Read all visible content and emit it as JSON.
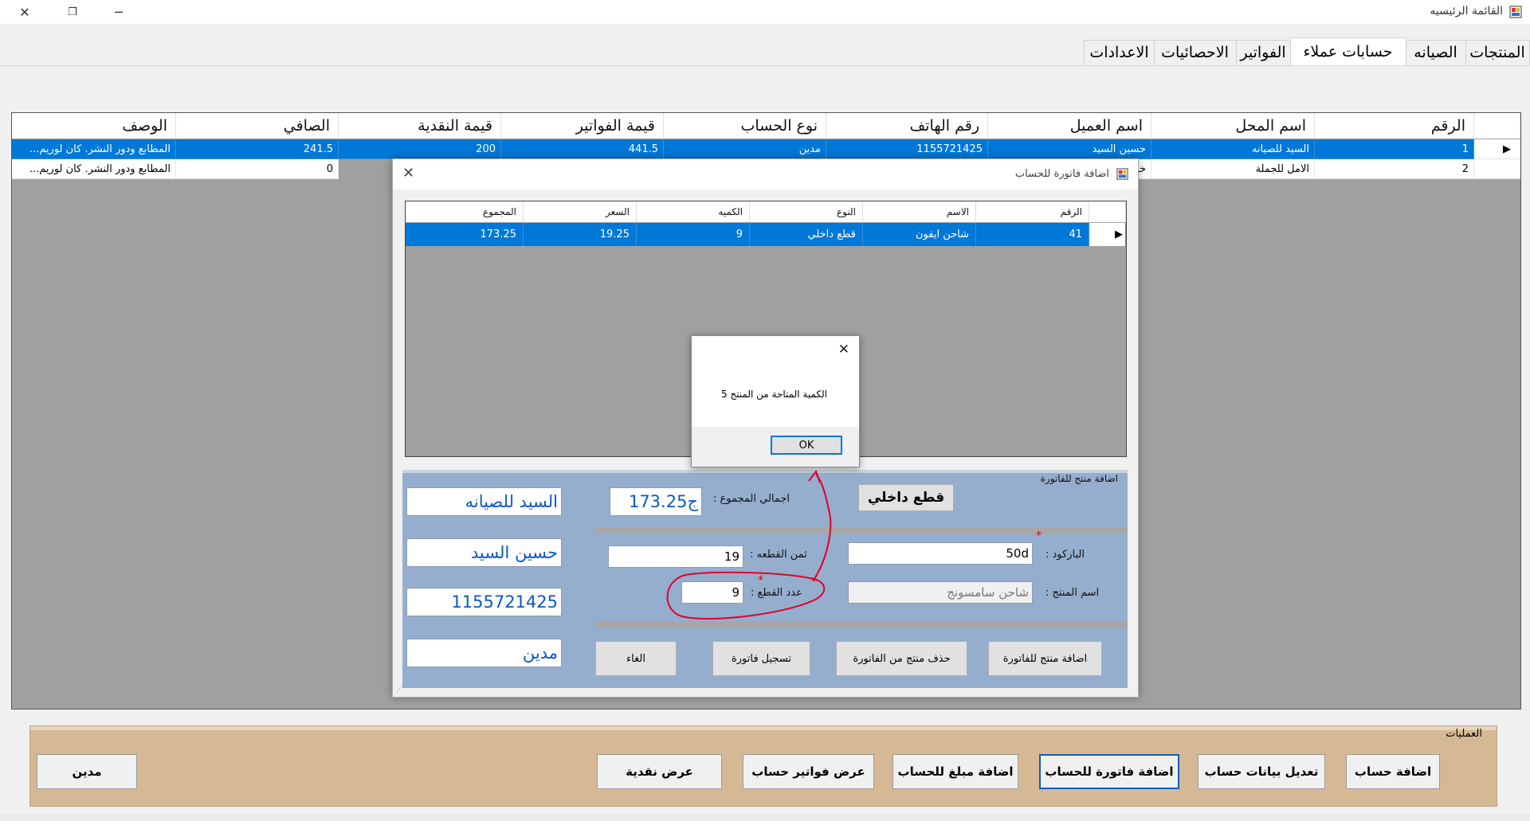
{
  "window": {
    "title": "القائمة الرئيسيه"
  },
  "tabs": [
    "المنتجات",
    "الصيانه",
    "حسابات عملاء",
    "الفواتير",
    "الاحصائيات",
    "الاعدادات"
  ],
  "main_grid": {
    "headers": [
      "الرقم",
      "اسم المحل",
      "اسم العميل",
      "رقم الهاتف",
      "نوع الحساب",
      "قيمة الفواتير",
      "قيمة النقدية",
      "الصافي",
      "الوصف"
    ],
    "rows": [
      [
        "1",
        "السيد للصيانه",
        "حسين السيد",
        "1155721425",
        "مدين",
        "441.5",
        "200",
        "241.5",
        "المطابع ودور النشر. كان لوريم..."
      ],
      [
        "2",
        "الامل للجملة",
        "خا",
        "",
        "",
        "",
        "",
        "0",
        "المطابع ودور النشر. كان لوريم..."
      ]
    ]
  },
  "invoice_dialog": {
    "title": "اضافة فاتورة للحساب",
    "grid_headers": [
      "الرقم",
      "الاسم",
      "النوع",
      "الكميه",
      "السعر",
      "المجموع"
    ],
    "grid_row": [
      "41",
      "شاحن ايفون",
      "قطع داخلي",
      "9",
      "19.25",
      "173.25"
    ],
    "panel_title": "اضافة منتج للفاتورة",
    "category_button": "قطع داخلي",
    "total_label": "اجمالي المجموع :",
    "total_value": "173.25ج",
    "shop_value": "السيد للصيانه",
    "customer_value": "حسين السيد",
    "phone_value": "1155721425",
    "account_type_value": "مدين",
    "barcode_label": "الباركود :",
    "barcode_value": "50d",
    "unit_price_label": "ثمن القطعه :",
    "unit_price_value": "19",
    "product_name_label": "اسم المنتج :",
    "product_name_value": "شاحن سامسونج",
    "pieces_label": "عدد القطع :",
    "pieces_value": "9",
    "buttons": {
      "add": "اضافة منتج للفاتورة",
      "remove": "حذف منتج من الفاتورة",
      "save": "تسجيل فاتورة",
      "cancel": "الغاء"
    }
  },
  "message_box": {
    "text": "الكمية المتاحة من المنتج 5",
    "ok": "OK"
  },
  "operations": {
    "title": "العمليات",
    "buttons": [
      "اضافة حساب",
      "تعديل بيانات حساب",
      "اضافة فاتورة للحساب",
      "اضافة مبلغ للحساب",
      "عرض فواتير حساب",
      "عرض نقدية",
      "مدين"
    ]
  },
  "colors": {
    "selection": "#0078d7",
    "panel": "#95aece",
    "ops_panel": "#d5b995",
    "annotation": "#e0002a"
  }
}
